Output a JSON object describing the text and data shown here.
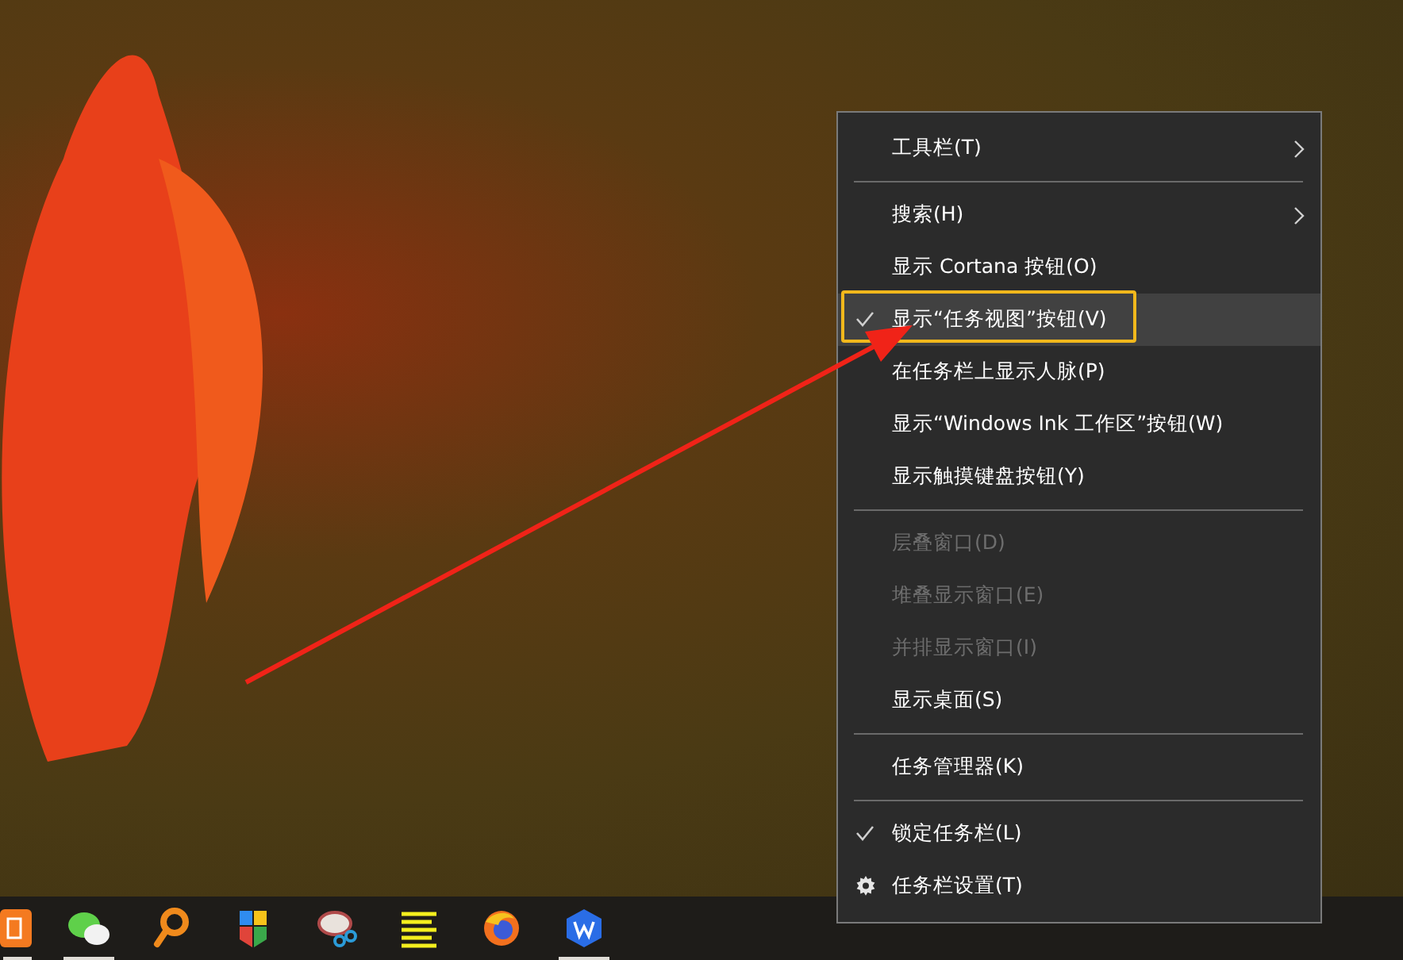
{
  "context_menu": {
    "items": [
      {
        "kind": "item",
        "label": "工具栏(T)",
        "submenu": true,
        "checked": false,
        "disabled": false,
        "hovered": false,
        "marked": false
      },
      {
        "kind": "separator"
      },
      {
        "kind": "item",
        "label": "搜索(H)",
        "submenu": true,
        "checked": false,
        "disabled": false,
        "hovered": false,
        "marked": false
      },
      {
        "kind": "item",
        "label": "显示 Cortana 按钮(O)",
        "submenu": false,
        "checked": false,
        "disabled": false,
        "hovered": false,
        "marked": false
      },
      {
        "kind": "item",
        "label": "显示“任务视图”按钮(V)",
        "submenu": false,
        "checked": true,
        "disabled": false,
        "hovered": true,
        "marked": true
      },
      {
        "kind": "item",
        "label": "在任务栏上显示人脉(P)",
        "submenu": false,
        "checked": false,
        "disabled": false,
        "hovered": false,
        "marked": false
      },
      {
        "kind": "item",
        "label": "显示“Windows Ink 工作区”按钮(W)",
        "submenu": false,
        "checked": false,
        "disabled": false,
        "hovered": false,
        "marked": false
      },
      {
        "kind": "item",
        "label": "显示触摸键盘按钮(Y)",
        "submenu": false,
        "checked": false,
        "disabled": false,
        "hovered": false,
        "marked": false
      },
      {
        "kind": "separator"
      },
      {
        "kind": "item",
        "label": "层叠窗口(D)",
        "submenu": false,
        "checked": false,
        "disabled": true,
        "hovered": false,
        "marked": false
      },
      {
        "kind": "item",
        "label": "堆叠显示窗口(E)",
        "submenu": false,
        "checked": false,
        "disabled": true,
        "hovered": false,
        "marked": false
      },
      {
        "kind": "item",
        "label": "并排显示窗口(I)",
        "submenu": false,
        "checked": false,
        "disabled": true,
        "hovered": false,
        "marked": false
      },
      {
        "kind": "item",
        "label": "显示桌面(S)",
        "submenu": false,
        "checked": false,
        "disabled": false,
        "hovered": false,
        "marked": false
      },
      {
        "kind": "separator"
      },
      {
        "kind": "item",
        "label": "任务管理器(K)",
        "submenu": false,
        "checked": false,
        "disabled": false,
        "hovered": false,
        "marked": false
      },
      {
        "kind": "separator"
      },
      {
        "kind": "item",
        "label": "锁定任务栏(L)",
        "submenu": false,
        "checked": true,
        "disabled": false,
        "hovered": false,
        "marked": false
      },
      {
        "kind": "settings",
        "label": "任务栏设置(T)",
        "submenu": false,
        "checked": false,
        "disabled": false,
        "hovered": false,
        "marked": false
      }
    ]
  },
  "taskbar": {
    "icons": [
      {
        "kind": "orange-app",
        "running": true
      },
      {
        "kind": "chat",
        "running": true
      },
      {
        "kind": "magnifier",
        "running": false
      },
      {
        "kind": "bookmark",
        "running": false
      },
      {
        "kind": "scissors",
        "running": false
      },
      {
        "kind": "lines",
        "running": false
      },
      {
        "kind": "browser",
        "running": false
      },
      {
        "kind": "office",
        "running": true
      }
    ]
  }
}
